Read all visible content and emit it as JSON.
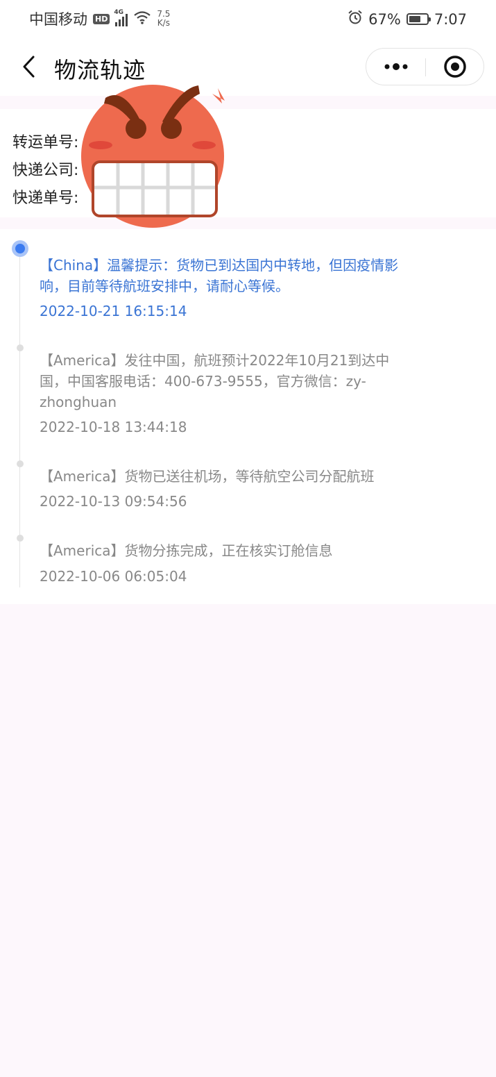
{
  "status_bar": {
    "carrier": "中国移动",
    "hd": "HD",
    "network": "4G",
    "speed_value": "7.5",
    "speed_unit": "K/s",
    "battery_percent": "67%",
    "battery_level": 0.67,
    "time": "7:07",
    "icons": [
      "signal-icon",
      "wifi-icon",
      "alarm-icon",
      "battery-icon"
    ]
  },
  "header": {
    "title": "物流轨迹",
    "back_icon": "chevron-left-icon",
    "more_icon": "more-dots-icon",
    "close_icon": "target-circle-icon"
  },
  "info": {
    "transfer_no_label": "转运单号:",
    "courier_company_label": "快递公司:",
    "courier_no_label": "快递单号:"
  },
  "timeline": [
    {
      "text": "【China】温馨提示：货物已到达国内中转地，但因疫情影响，目前等待航班安排中，请耐心等候。",
      "time": "2022-10-21 16:15:14",
      "active": true
    },
    {
      "text": "【America】发往中国，航班预计2022年10月21到达中国，中国客服电话：400-673-9555，官方微信：zy-zhonghuan",
      "time": "2022-10-18 13:44:18",
      "active": false
    },
    {
      "text": "【America】货物已送往机场，等待航空公司分配航班",
      "time": "2022-10-13 09:54:56",
      "active": false
    },
    {
      "text": "【America】货物分拣完成，正在核实订舱信息",
      "time": "2022-10-06 06:05:04",
      "active": false
    }
  ],
  "colors": {
    "accent_blue": "#3a74d4",
    "muted_text": "#888888",
    "page_bg": "#fdf7fc"
  }
}
